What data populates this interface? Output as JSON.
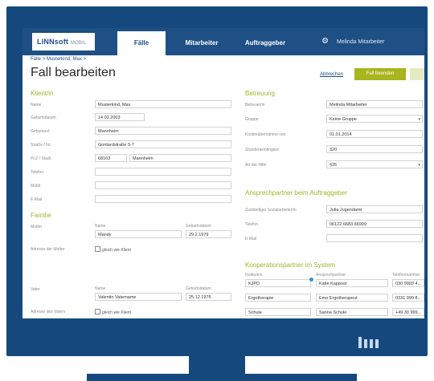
{
  "nav": {
    "logo_main": "LINNsoft",
    "logo_sub": "MOBIL",
    "tabs": [
      "Fälle",
      "Mitarbeiter",
      "Auftraggeber"
    ],
    "user": "Melinda Mitarbeiter"
  },
  "breadcrumb": "Fälle > Musterkind, Max >",
  "page_title": "Fall bearbeiten",
  "actions": {
    "cancel": "Abbrechen",
    "finish": "Fall beenden"
  },
  "klient": {
    "heading": "Klient/in",
    "labels": [
      "Name",
      "Geburtsdatum",
      "Geburtsort",
      "Straße / Nr.",
      "PLZ / Stadt",
      "Telefon",
      "Mobil",
      "E-Mail"
    ],
    "name": "Musterkind, Max",
    "birthdate": "14.02.2003",
    "birthplace": "Mannheim",
    "street": "Gontardstraße 5-7",
    "zip": "68163",
    "city": "Mannheim"
  },
  "familie": {
    "heading": "Familie",
    "mother_label": "Mutter",
    "name_label": "Name",
    "birth_label": "Geburtsdatum",
    "mother_name": "Mandy",
    "mother_birth": "29.2.1979",
    "mother_address_label": "Adresse der Mutter",
    "same_as_client": "gleich wie Klient",
    "father_label": "Vater",
    "father_name": "Valentin Vatername",
    "father_birth": "25.12.1975",
    "father_address_label": "Adresse des Vaters"
  },
  "betreuung": {
    "heading": "Betreuung",
    "labels": [
      "Betreuer/in",
      "Gruppe",
      "Kostenübernahme von",
      "Stundenkontingent",
      "Art der Hilfe"
    ],
    "betreuer": "Melinda Mitarbeiter",
    "gruppe": "Keine Gruppe",
    "kostenuebernahme": "01.01.2014",
    "stunden": "320",
    "art": "§35"
  },
  "ansprechpartner": {
    "heading": "Ansprechpartner beim Auftraggeber",
    "labels": [
      "Zuständiger Sozialarbeiter/in",
      "Telefon",
      "E-Mail"
    ],
    "name": "Julia Jugendamt",
    "telefon": "06122 6683 66999"
  },
  "kooperation": {
    "heading": "Kooperationspartner im System",
    "col_headers": [
      "Institution",
      "Ansprechpartner",
      "Telefonnummer"
    ],
    "rows": [
      {
        "institution": "KJPD",
        "contact": "Katie Kappost",
        "phone": "030 9993 4..."
      },
      {
        "institution": "Ergotherapie",
        "contact": "Emo Ergotherapeut",
        "phone": "0331 999 8..."
      },
      {
        "institution": "Schule",
        "contact": "Sanne Schule",
        "phone": "+49 30 999..."
      }
    ]
  }
}
